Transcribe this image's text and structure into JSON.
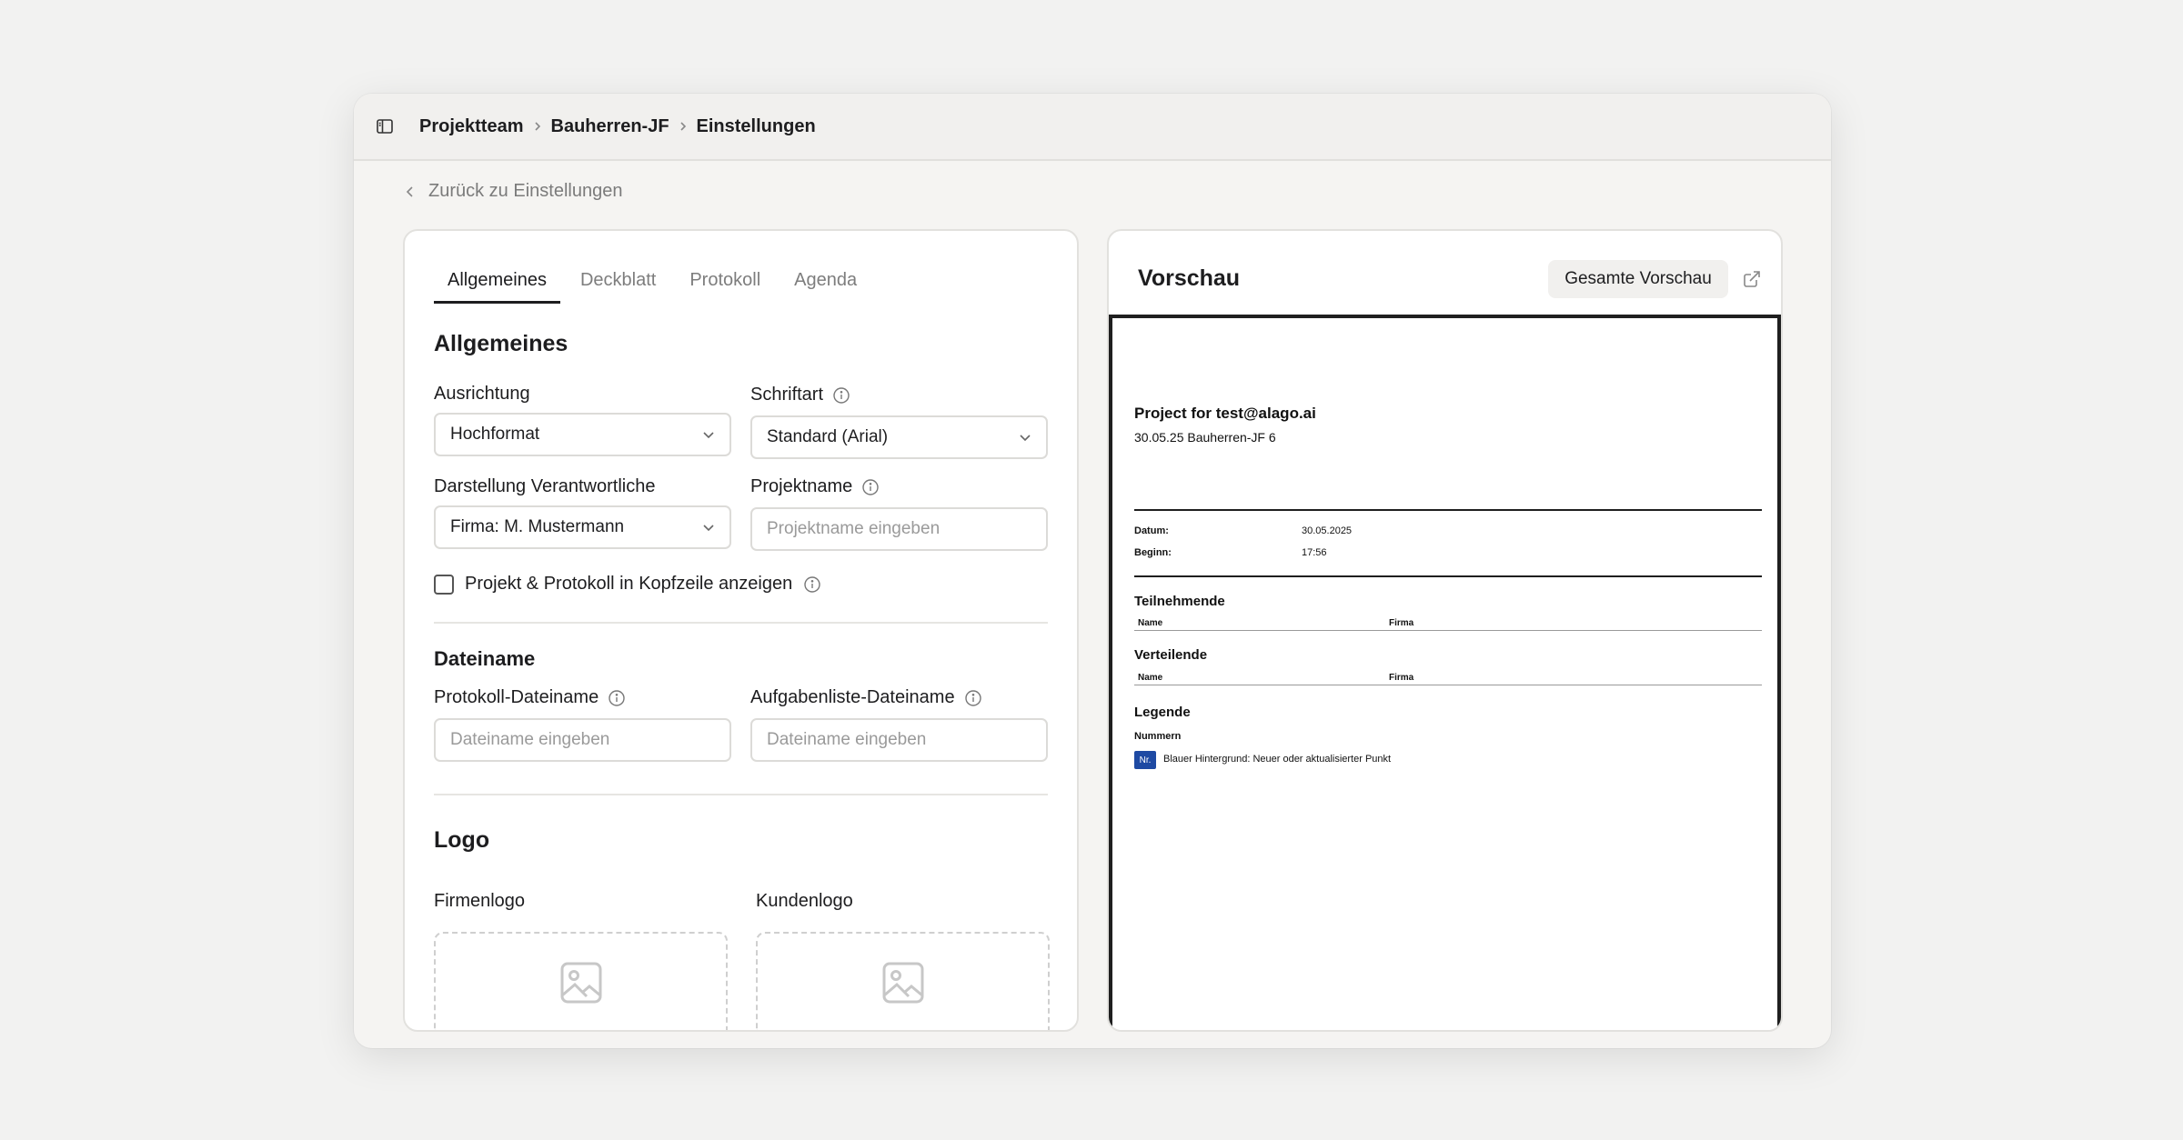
{
  "breadcrumb": {
    "items": [
      "Projektteam",
      "Bauherren-JF",
      "Einstellungen"
    ]
  },
  "back_link": {
    "label": "Zurück zu Einstellungen"
  },
  "tabs": [
    "Allgemeines",
    "Deckblatt",
    "Protokoll",
    "Agenda"
  ],
  "active_tab": "Allgemeines",
  "general": {
    "title": "Allgemeines",
    "orientation": {
      "label": "Ausrichtung",
      "value": "Hochformat"
    },
    "font": {
      "label": "Schriftart",
      "value": "Standard (Arial)"
    },
    "responsible": {
      "label": "Darstellung Verantwortliche",
      "value": "Firma: M. Mustermann"
    },
    "project_name": {
      "label": "Projektname",
      "placeholder": "Projektname eingeben"
    },
    "header_checkbox": {
      "label": "Projekt & Protokoll in Kopfzeile anzeigen",
      "checked": false
    }
  },
  "filename": {
    "title": "Dateiname",
    "protocol": {
      "label": "Protokoll-Dateiname",
      "placeholder": "Dateiname eingeben"
    },
    "tasklist": {
      "label": "Aufgabenliste-Dateiname",
      "placeholder": "Dateiname eingeben"
    }
  },
  "logo": {
    "title": "Logo",
    "company": "Firmenlogo",
    "client": "Kundenlogo"
  },
  "preview": {
    "title": "Vorschau",
    "full_preview_button": "Gesamte Vorschau",
    "document": {
      "project_title": "Project for test@alago.ai",
      "subtitle": "30.05.25 Bauherren-JF 6",
      "date_label": "Datum:",
      "date_value": "30.05.2025",
      "start_label": "Beginn:",
      "start_value": "17:56",
      "participants_title": "Teilnehmende",
      "distributors_title": "Verteilende",
      "col_name": "Name",
      "col_company": "Firma",
      "legend_title": "Legende",
      "legend_numbers": "Nummern",
      "legend_badge": "Nr.",
      "legend_badge_color": "#1e4aa3",
      "legend_text": "Blauer Hintergrund: Neuer oder aktualisierter Punkt"
    }
  }
}
